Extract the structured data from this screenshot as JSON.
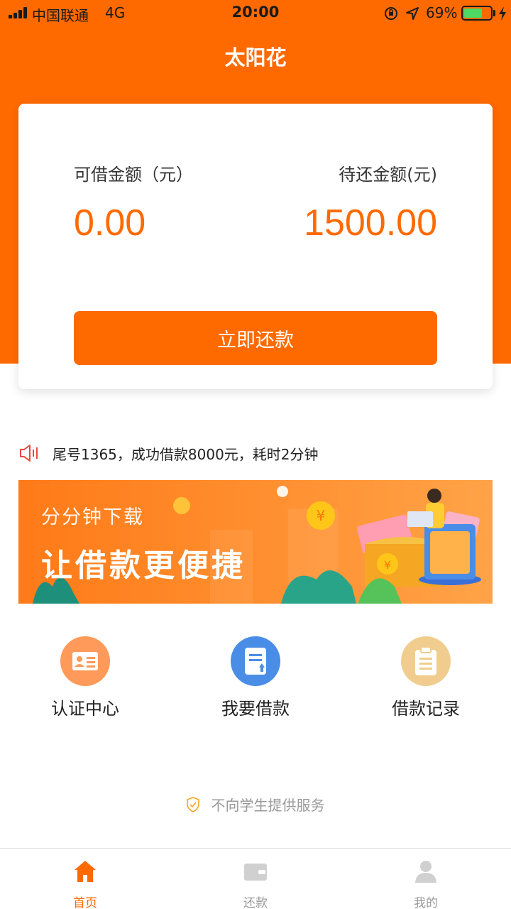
{
  "status_bar": {
    "carrier": "中国联通",
    "network": "4G",
    "time": "20:00",
    "battery_percent": "69%",
    "battery_level": 0.69
  },
  "header": {
    "title": "太阳花"
  },
  "summary_card": {
    "available_label": "可借金额（元）",
    "available_value": "0.00",
    "pending_label": "待还金额(元)",
    "pending_value": "1500.00",
    "repay_button": "立即还款"
  },
  "notice": {
    "text": "尾号1365，成功借款8000元，耗时2分钟",
    "icon": "speaker-icon"
  },
  "banner": {
    "subtitle": "分分钟下载",
    "headline": "让借款更便捷"
  },
  "shortcuts": [
    {
      "label": "认证中心",
      "icon": "id-card-icon",
      "color": "#ff9a5a"
    },
    {
      "label": "我要借款",
      "icon": "loan-form-icon",
      "color": "#4a8de6"
    },
    {
      "label": "借款记录",
      "icon": "clipboard-icon",
      "color": "#f0cd8e"
    }
  ],
  "footer_note": {
    "text": "不向学生提供服务",
    "icon": "shield-check-icon"
  },
  "tab_bar": {
    "items": [
      {
        "label": "首页",
        "icon": "home-icon",
        "active": true
      },
      {
        "label": "还款",
        "icon": "wallet-icon",
        "active": false
      },
      {
        "label": "我的",
        "icon": "user-icon",
        "active": false
      }
    ]
  },
  "colors": {
    "brand": "#ff6a00",
    "muted": "#999999"
  }
}
